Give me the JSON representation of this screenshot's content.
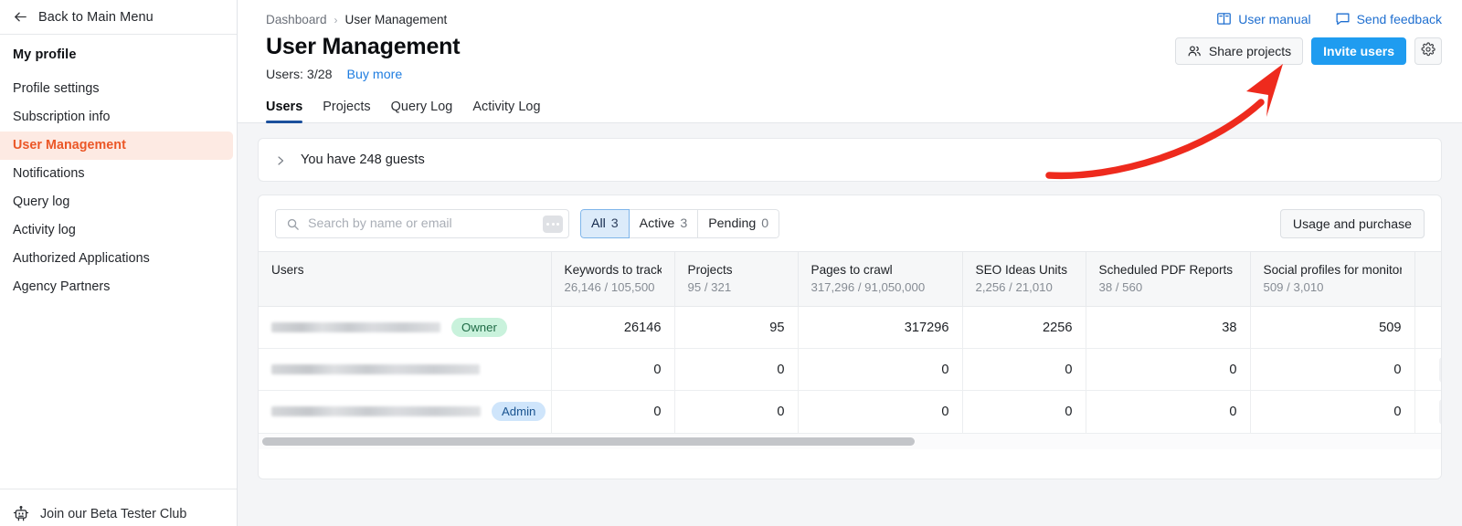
{
  "sidebar": {
    "back_label": "Back to Main Menu",
    "section_title": "My profile",
    "items": [
      {
        "label": "Profile settings",
        "active": false
      },
      {
        "label": "Subscription info",
        "active": false
      },
      {
        "label": "User Management",
        "active": true
      },
      {
        "label": "Notifications",
        "active": false
      },
      {
        "label": "Query log",
        "active": false
      },
      {
        "label": "Activity log",
        "active": false
      },
      {
        "label": "Authorized Applications",
        "active": false
      },
      {
        "label": "Agency Partners",
        "active": false
      }
    ],
    "beta_label": "Join our Beta Tester Club"
  },
  "header": {
    "breadcrumb_root": "Dashboard",
    "breadcrumb_sep": "›",
    "breadcrumb_current": "User Management",
    "title": "User Management",
    "users_count": "Users: 3/28",
    "buy_more": "Buy more",
    "user_manual": "User manual",
    "send_feedback": "Send feedback",
    "share_projects": "Share projects",
    "invite_users": "Invite users"
  },
  "tabs": [
    {
      "label": "Users",
      "active": true
    },
    {
      "label": "Projects",
      "active": false
    },
    {
      "label": "Query Log",
      "active": false
    },
    {
      "label": "Activity Log",
      "active": false
    }
  ],
  "guests": {
    "text": "You have 248 guests"
  },
  "toolbar": {
    "search_placeholder": "Search by name or email",
    "search_value": "",
    "filters": [
      {
        "label": "All",
        "count": "3",
        "active": true
      },
      {
        "label": "Active",
        "count": "3",
        "active": false
      },
      {
        "label": "Pending",
        "count": "0",
        "active": false
      }
    ],
    "usage_button": "Usage and purchase"
  },
  "table": {
    "columns": [
      {
        "name": "Users",
        "sub": ""
      },
      {
        "name": "Keywords to track",
        "sub": "26,146 / 105,500"
      },
      {
        "name": "Projects",
        "sub": "95 / 321"
      },
      {
        "name": "Pages to crawl",
        "sub": "317,296 / 91,050,000"
      },
      {
        "name": "SEO Ideas Units",
        "sub": "2,256 / 21,010"
      },
      {
        "name": "Scheduled PDF Reports",
        "sub": "38 / 560"
      },
      {
        "name": "Social profiles for monitoring",
        "sub": "509 / 3,010"
      }
    ],
    "rows": [
      {
        "user_redacted_width": 185,
        "role": "Owner",
        "role_kind": "owner",
        "values": [
          "26146",
          "95",
          "317296",
          "2256",
          "38",
          "509"
        ],
        "has_actions": false
      },
      {
        "user_redacted_width": 228,
        "role": "",
        "role_kind": "",
        "values": [
          "0",
          "0",
          "0",
          "0",
          "0",
          "0"
        ],
        "has_actions": true
      },
      {
        "user_redacted_width": 229,
        "role": "Admin",
        "role_kind": "admin",
        "values": [
          "0",
          "0",
          "0",
          "0",
          "0",
          "0"
        ],
        "has_actions": true
      }
    ]
  },
  "colors": {
    "accent_blue": "#1f9cf0",
    "link_blue": "#1f6fd0",
    "sidebar_active_text": "#eb5727",
    "sidebar_active_bg": "#fdeae3",
    "tab_underline": "#1b4f9c",
    "badge_owner_bg": "#c9f2dc",
    "badge_admin_bg": "#cfe5fb",
    "annotation_arrow": "#ee2a1d"
  },
  "annotation": {
    "arrow_name": "red-curved-arrow-to-invite-users"
  }
}
